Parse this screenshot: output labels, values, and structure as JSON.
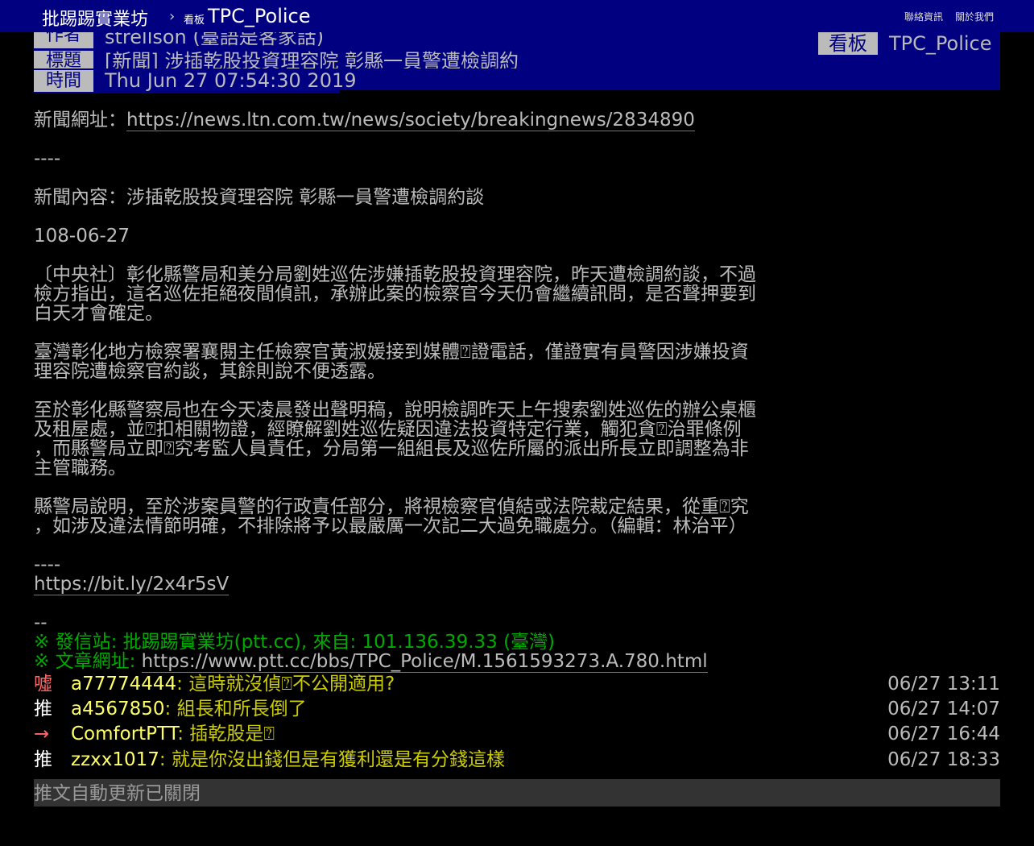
{
  "topbar": {
    "site": "批踢踢實業坊",
    "separator": "›",
    "board_label": "看板",
    "board_name": "TPC_Police",
    "contact": "聯絡資訊",
    "about": "關於我們"
  },
  "meta": {
    "author_tag": "作者",
    "author": "strellson (臺語是客家話)",
    "title_tag": "標題",
    "title": "[新聞] 涉插乾股投資理容院 彰縣一員警遭檢調約",
    "time_tag": "時間",
    "time": "Thu Jun 27 07:54:30 2019",
    "board_tag": "看板",
    "board": "TPC_Police"
  },
  "content": {
    "news_url_label": "新聞網址：",
    "news_url": "https://news.ltn.com.tw/news/society/breakingnews/2834890",
    "divider1": "----",
    "news_title": "新聞內容：涉插乾股投資理容院 彰縣一員警遭檢調約談",
    "date": "108-06-27",
    "p1_l1": "〔中央社〕彰化縣警局和美分局劉姓巡佐涉嫌插乾股投資理容院，昨天遭檢調約談，不過",
    "p1_l2": "檢方指出，這名巡佐拒絕夜間偵訊，承辦此案的檢察官今天仍會繼續訊問，是否聲押要到",
    "p1_l3": "白天才會確定。",
    "p2_l1": "臺灣彰化地方檢察署襄閱主任檢察官黃淑媛接到媒體⍰證電話，僅證實有員警因涉嫌投資",
    "p2_l2": "理容院遭檢察官約談，其餘則說不便透露。",
    "p3_l1": "至於彰化縣警察局也在今天凌晨發出聲明稿，說明檢調昨天上午搜索劉姓巡佐的辦公桌櫃",
    "p3_l2": "及租屋處，並⍰扣相關物證，經瞭解劉姓巡佐疑因違法投資特定行業，觸犯貪⍰治罪條例",
    "p3_l3": "，而縣警局立即⍰究考監人員責任，分局第一組組長及巡佐所屬的派出所長立即調整為非",
    "p3_l4": "主管職務。",
    "p4_l1": "縣警局說明，至於涉案員警的行政責任部分，將視檢察官偵結或法院裁定結果，從重⍰究",
    "p4_l2": "，如涉及違法情節明確，不排除將予以最嚴厲一次記二大過免職處分。（編輯：林治平）",
    "divider2": "----",
    "short_url": "https://bit.ly/2x4r5sV",
    "sig_divider": "--",
    "origin_line": "※ 發信站: 批踢踢實業坊(ptt.cc), 來自: 101.136.39.33 (臺灣)",
    "article_url_label": "※ 文章網址: ",
    "article_url": "https://www.ptt.cc/bbs/TPC_Police/M.1561593273.A.780.html"
  },
  "pushes": [
    {
      "tag": "噓",
      "user": "a77774444",
      "content": ": 這時就沒偵⍰不公開適用?",
      "time": "06/27 13:11"
    },
    {
      "tag": "推",
      "user": "a4567850",
      "content": ": 組長和所長倒了",
      "time": "06/27 14:07"
    },
    {
      "tag": "→",
      "user": "ComfortPTT",
      "content": ": 插乾股是⍰",
      "time": "06/27 16:44"
    },
    {
      "tag": "推",
      "user": "zzxx1017",
      "content": ": 就是你沒出錢但是有獲利還是有分錢這樣",
      "time": "06/27 18:33"
    }
  ],
  "footer": {
    "auto_update": "推文自動更新已關閉"
  }
}
